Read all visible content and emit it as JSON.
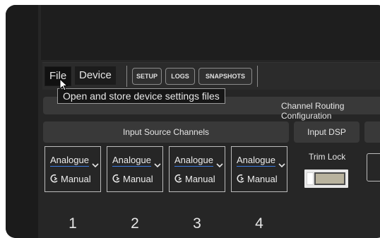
{
  "menubar": {
    "file_label": "File",
    "device_label": "Device",
    "buttons": [
      "SETUP",
      "LOGS",
      "SNAPSHOTS"
    ]
  },
  "tooltip": {
    "text": "Open and store device settings files"
  },
  "routing": {
    "title": "Channel Routing Configuration"
  },
  "sections": {
    "input_source": "Input Source Channels",
    "input_dsp": "Input DSP"
  },
  "channels": [
    {
      "source": "Analogue",
      "mode": "Manual",
      "number": "1"
    },
    {
      "source": "Analogue",
      "mode": "Manual",
      "number": "2"
    },
    {
      "source": "Analogue",
      "mode": "Manual",
      "number": "3"
    },
    {
      "source": "Analogue",
      "mode": "Manual",
      "number": "4"
    }
  ],
  "trim": {
    "label": "Trim Lock",
    "locked": false
  },
  "icons": {
    "chevron": "chevron-down-icon",
    "mode": "auto-manual-icon",
    "cursor": "mouse-pointer-icon"
  }
}
